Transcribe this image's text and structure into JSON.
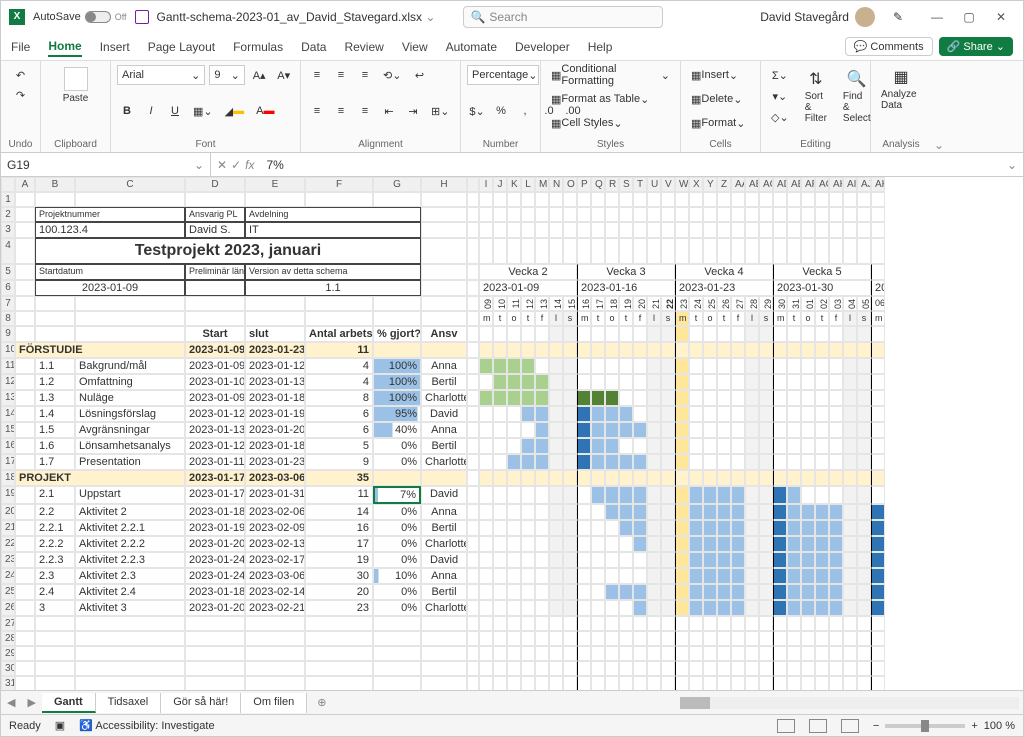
{
  "title": {
    "autosave": "AutoSave",
    "autosave_state": "Off",
    "filename": "Gantt-schema-2023-01_av_David_Stavegard.xlsx",
    "search_placeholder": "Search",
    "username": "David Stavegård"
  },
  "menus": [
    "File",
    "Home",
    "Insert",
    "Page Layout",
    "Formulas",
    "Data",
    "Review",
    "View",
    "Automate",
    "Developer",
    "Help"
  ],
  "active_menu": "Home",
  "rightbtns": {
    "comments": "Comments",
    "share": "Share"
  },
  "ribbon": {
    "groups": [
      "Undo",
      "Clipboard",
      "Font",
      "Alignment",
      "Number",
      "Styles",
      "Cells",
      "Editing",
      "Analysis"
    ],
    "paste": "Paste",
    "font_name": "Arial",
    "font_size": "9",
    "number_format": "Percentage",
    "cond_fmt": "Conditional Formatting",
    "fmt_table": "Format as Table",
    "cell_styles": "Cell Styles",
    "insert": "Insert",
    "delete": "Delete",
    "format": "Format",
    "sort": "Sort & Filter",
    "find": "Find & Select",
    "analyze": "Analyze Data"
  },
  "formula": {
    "namebox": "G19",
    "fx": "fx",
    "value": "7%"
  },
  "cols": [
    "A",
    "B",
    "C",
    "D",
    "E",
    "F",
    "G",
    "H",
    "I",
    "J",
    "K",
    "L",
    "M",
    "N",
    "O",
    "P",
    "Q",
    "R",
    "S",
    "T",
    "U",
    "V",
    "W",
    "X",
    "Y",
    "Z",
    "AA",
    "AB",
    "AC",
    "AD",
    "AE",
    "AF",
    "AG",
    "AH",
    "AI",
    "AJ",
    "AK"
  ],
  "proj": {
    "lbl_num": "Projektnummer",
    "num": "100.123.4",
    "lbl_ansv": "Ansvarig PL",
    "ansv": "David S.",
    "lbl_avd": "Avdelning",
    "avd": "IT",
    "title": "Testprojekt 2023, januari",
    "lbl_start": "Startdatum",
    "start": "2023-01-09",
    "lbl_prel": "Preliminär längd i veckor",
    "lbl_ver": "Version av detta schema",
    "ver": "1.1"
  },
  "weeks": [
    {
      "label": "Vecka 2",
      "date": "2023-01-09",
      "days": [
        "09",
        "10",
        "11",
        "12",
        "13",
        "14",
        "15"
      ],
      "wd": [
        "m",
        "t",
        "o",
        "t",
        "f",
        "l",
        "s"
      ]
    },
    {
      "label": "Vecka 3",
      "date": "2023-01-16",
      "days": [
        "16",
        "17",
        "18",
        "19",
        "20",
        "21",
        "22"
      ],
      "wd": [
        "m",
        "t",
        "o",
        "t",
        "f",
        "l",
        "s"
      ]
    },
    {
      "label": "Vecka 4",
      "date": "2023-01-23",
      "days": [
        "23",
        "24",
        "25",
        "26",
        "27",
        "28",
        "29"
      ],
      "wd": [
        "m",
        "t",
        "o",
        "t",
        "f",
        "l",
        "s"
      ]
    },
    {
      "label": "Vecka 5",
      "date": "2023-01-30",
      "days": [
        "30",
        "31",
        "01",
        "02",
        "03",
        "04",
        "05"
      ],
      "wd": [
        "m",
        "t",
        "o",
        "t",
        "f",
        "l",
        "s"
      ]
    }
  ],
  "extra_day": "06",
  "hdr": {
    "start": "Start",
    "slut": "slut",
    "dagar": "Antal arbetsdagar",
    "pct": "% gjort?",
    "ansv": "Ansv"
  },
  "sections": [
    {
      "name": "FÖRSTUDIE",
      "start": "2023-01-09",
      "slut": "2023-01-23",
      "dagar": "11",
      "rows": [
        {
          "id": "1.1",
          "task": "Bakgrund/mål",
          "start": "2023-01-09",
          "slut": "2023-01-12",
          "dagar": "4",
          "pct": "100%",
          "ansv": "Anna",
          "bar": [
            0,
            4
          ],
          "done": 4
        },
        {
          "id": "1.2",
          "task": "Omfattning",
          "start": "2023-01-10",
          "slut": "2023-01-13",
          "dagar": "4",
          "pct": "100%",
          "ansv": "Bertil",
          "bar": [
            1,
            4
          ],
          "done": 4
        },
        {
          "id": "1.3",
          "task": "Nuläge",
          "start": "2023-01-09",
          "slut": "2023-01-18",
          "dagar": "8",
          "pct": "100%",
          "ansv": "Charlotte",
          "bar": [
            0,
            8
          ],
          "done": 8,
          "green2": [
            5,
            3
          ]
        },
        {
          "id": "1.4",
          "task": "Lösningsförslag",
          "start": "2023-01-12",
          "slut": "2023-01-19",
          "dagar": "6",
          "pct": "95%",
          "ansv": "David",
          "bar": [
            3,
            6
          ],
          "blue": true
        },
        {
          "id": "1.5",
          "task": "Avgränsningar",
          "start": "2023-01-13",
          "slut": "2023-01-20",
          "dagar": "6",
          "pct": "40%",
          "ansv": "Anna",
          "bar": [
            4,
            6
          ],
          "blue": true
        },
        {
          "id": "1.6",
          "task": "Lönsamhetsanalys",
          "start": "2023-01-12",
          "slut": "2023-01-18",
          "dagar": "5",
          "pct": "0%",
          "ansv": "Bertil",
          "bar": [
            3,
            5
          ],
          "blue": true
        },
        {
          "id": "1.7",
          "task": "Presentation",
          "start": "2023-01-11",
          "slut": "2023-01-23",
          "dagar": "9",
          "pct": "0%",
          "ansv": "Charlotte",
          "bar": [
            2,
            9
          ],
          "blue": true
        }
      ]
    },
    {
      "name": "PROJEKT",
      "start": "2023-01-17",
      "slut": "2023-03-06",
      "dagar": "35",
      "rows": [
        {
          "id": "2.1",
          "task": "Uppstart",
          "start": "2023-01-17",
          "slut": "2023-01-31",
          "dagar": "11",
          "pct": "7%",
          "ansv": "David",
          "bar": [
            6,
            11
          ],
          "blue": true,
          "sel": true
        },
        {
          "id": "2.2",
          "task": "Aktivitet 2",
          "start": "2023-01-18",
          "slut": "2023-02-06",
          "dagar": "14",
          "pct": "0%",
          "ansv": "Anna",
          "bar": [
            7,
            14
          ],
          "blue": true
        },
        {
          "id": "2.2.1",
          "task": "Aktivitet 2.2.1",
          "start": "2023-01-19",
          "slut": "2023-02-09",
          "dagar": "16",
          "pct": "0%",
          "ansv": "Bertil",
          "bar": [
            8,
            16
          ],
          "blue": true
        },
        {
          "id": "2.2.2",
          "task": "Aktivitet 2.2.2",
          "start": "2023-01-20",
          "slut": "2023-02-13",
          "dagar": "17",
          "pct": "0%",
          "ansv": "Charlotte",
          "bar": [
            9,
            17
          ],
          "blue": true
        },
        {
          "id": "2.2.3",
          "task": "Aktivitet 2.2.3",
          "start": "2023-01-24",
          "slut": "2023-02-17",
          "dagar": "19",
          "pct": "0%",
          "ansv": "David",
          "bar": [
            11,
            19
          ],
          "blue": true
        },
        {
          "id": "2.3",
          "task": "Aktivitet 2.3",
          "start": "2023-01-24",
          "slut": "2023-03-06",
          "dagar": "30",
          "pct": "10%",
          "ansv": "Anna",
          "bar": [
            11,
            30
          ],
          "blue": true
        },
        {
          "id": "2.4",
          "task": "Aktivitet 2.4",
          "start": "2023-01-18",
          "slut": "2023-02-14",
          "dagar": "20",
          "pct": "0%",
          "ansv": "Bertil",
          "bar": [
            7,
            20
          ],
          "blue": true
        },
        {
          "id": "3",
          "task": "Aktivitet 3",
          "start": "2023-01-20",
          "slut": "2023-02-21",
          "dagar": "23",
          "pct": "0%",
          "ansv": "Charlotte",
          "bar": [
            9,
            23
          ],
          "blue": true
        }
      ]
    }
  ],
  "sheets": [
    "Gantt",
    "Tidsaxel",
    "Gör så här!",
    "Om filen"
  ],
  "active_sheet": "Gantt",
  "status": {
    "ready": "Ready",
    "access": "Accessibility: Investigate",
    "zoom": "100 %"
  }
}
